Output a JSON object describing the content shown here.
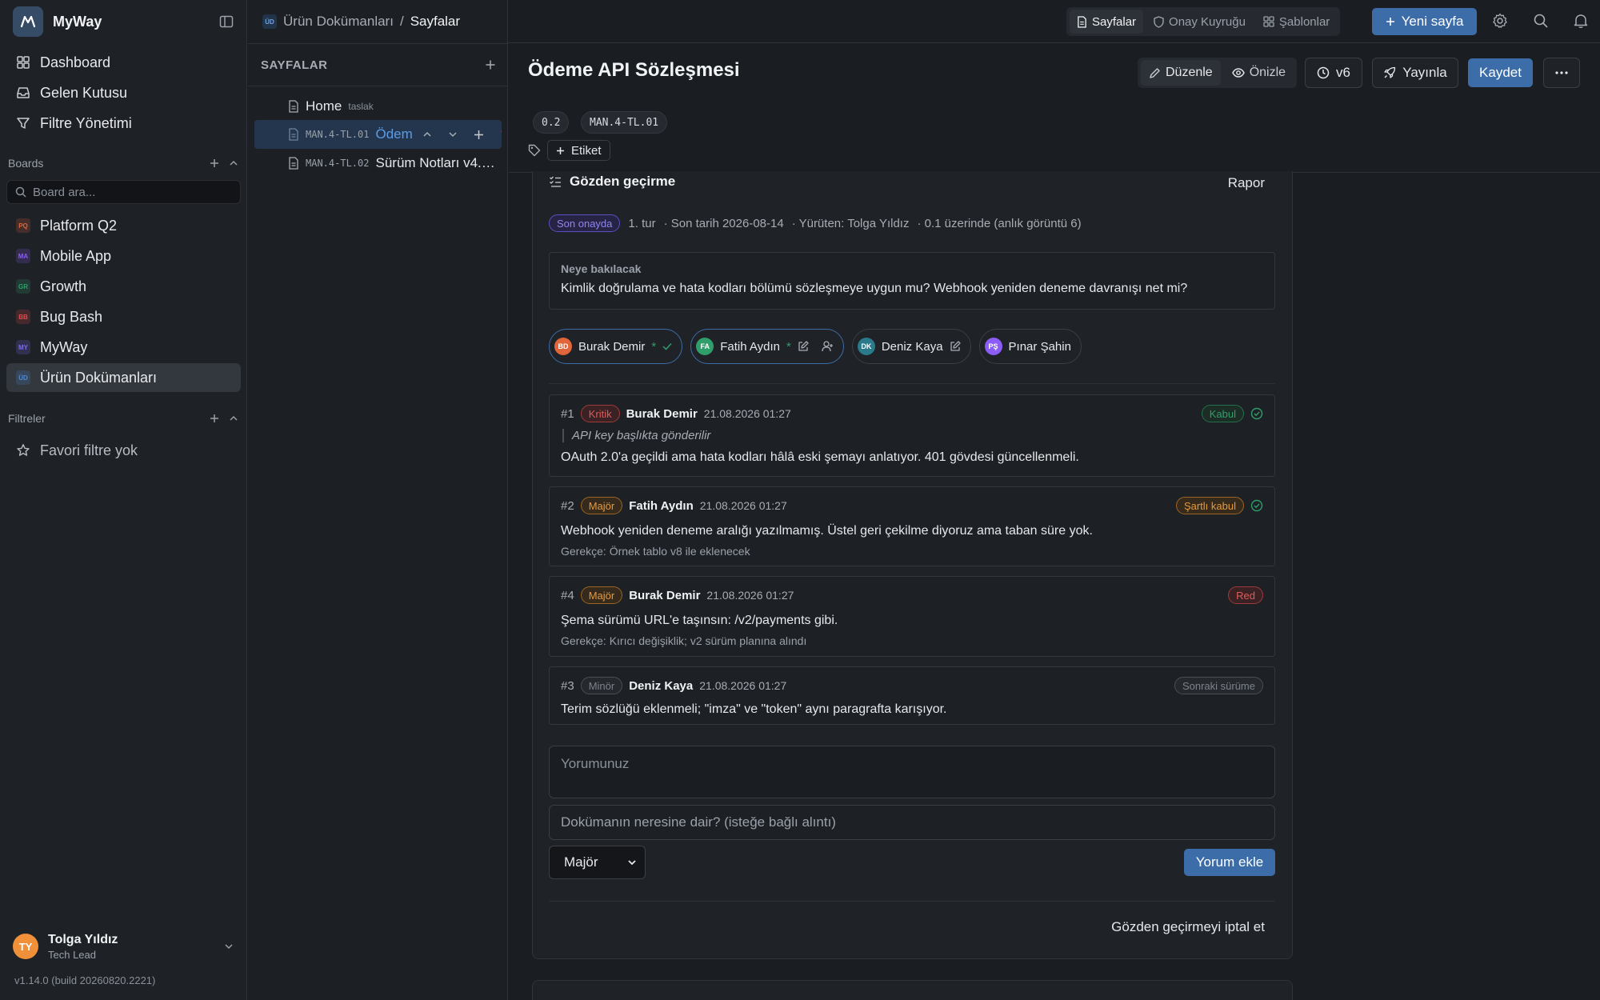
{
  "app": {
    "name": "MyWay",
    "version": "v1.14.0 (build 20260820.2221)"
  },
  "nav": [
    {
      "label": "Dashboard",
      "icon": "dashboard-icon"
    },
    {
      "label": "Gelen Kutusu",
      "icon": "inbox-icon"
    },
    {
      "label": "Filtre Yönetimi",
      "icon": "filter-icon"
    }
  ],
  "boards": {
    "title": "Boards",
    "search_placeholder": "Board ara...",
    "items": [
      {
        "badge": "PQ",
        "label": "Platform Q2",
        "color": "#e0653a"
      },
      {
        "badge": "MA",
        "label": "Mobile App",
        "color": "#8b5cf6"
      },
      {
        "badge": "GR",
        "label": "Growth",
        "color": "#2f9e6a"
      },
      {
        "badge": "BB",
        "label": "Bug Bash",
        "color": "#e04a4a"
      },
      {
        "badge": "MY",
        "label": "MyWay",
        "color": "#7c6cf0"
      },
      {
        "badge": "ÜD",
        "label": "Ürün Dokümanları",
        "color": "#4a8ad8"
      }
    ]
  },
  "filters": {
    "title": "Filtreler",
    "empty": "Favori filtre yok"
  },
  "user": {
    "initials": "TY",
    "name": "Tolga Yıldız",
    "role": "Tech Lead"
  },
  "breadcrumb": {
    "badge": "ÜD",
    "space": "Ürün Dokümanları",
    "separator": "/",
    "current": "Sayfalar"
  },
  "pages_panel": {
    "title": "SAYFALAR",
    "tree": [
      {
        "code": "",
        "label": "Home",
        "tag": "taslak"
      },
      {
        "code": "MAN.4-TL.01",
        "label": "Ödem",
        "tag": ""
      },
      {
        "code": "MAN.4-TL.02",
        "label": "Sürüm Notları v4.…",
        "tag": ""
      }
    ]
  },
  "topbar": {
    "tabs": [
      {
        "label": "Sayfalar",
        "icon": "document-icon"
      },
      {
        "label": "Onay Kuyruğu",
        "icon": "shield-icon"
      },
      {
        "label": "Şablonlar",
        "icon": "grid-icon"
      }
    ],
    "new_page": "Yeni sayfa"
  },
  "doc": {
    "title": "Ödeme API Sözleşmesi",
    "mode_edit": "Düzenle",
    "mode_preview": "Önizle",
    "version": "v6",
    "publish": "Yayınla",
    "save": "Kaydet",
    "chips": [
      "0.2",
      "MAN.4-TL.01"
    ],
    "tag_button": "Etiket"
  },
  "review": {
    "title": "Gözden geçirme",
    "report": "Rapor",
    "status": "Son onayda",
    "meta": [
      "1. tur",
      "· Son tarih 2026-08-14",
      "· Yürüten: Tolga Yıldız",
      "· 0.1 üzerinde (anlık görüntü 6)"
    ],
    "focus_label": "Neye bakılacak",
    "focus_text": "Kimlik doğrulama ve hata kodları bölümü sözleşmeye uygun mu? Webhook yeniden deneme davranışı net mi?",
    "reviewers": [
      {
        "initials": "BD",
        "name": "Burak Demir",
        "color": "#e0653a"
      },
      {
        "initials": "FA",
        "name": "Fatih Aydın",
        "color": "#2f9e6a"
      },
      {
        "initials": "DK",
        "name": "Deniz Kaya",
        "color": "#2a7a8c"
      },
      {
        "initials": "PŞ",
        "name": "Pınar Şahin",
        "color": "#8b5cf6"
      }
    ],
    "comments": [
      {
        "num": "#1",
        "severity": "Kritik",
        "author": "Burak Demir",
        "time": "21.08.2026 01:27",
        "quote": "API key başlıkta gönderilir",
        "text": "OAuth 2.0'a geçildi ama hata kodları hâlâ eski şemayı anlatıyor. 401 gövdesi güncellenmeli.",
        "reason": "",
        "status": "Kabul"
      },
      {
        "num": "#2",
        "severity": "Majör",
        "author": "Fatih Aydın",
        "time": "21.08.2026 01:27",
        "quote": "",
        "text": "Webhook yeniden deneme aralığı yazılmamış. Üstel geri çekilme diyoruz ama taban süre yok.",
        "reason": "Gerekçe: Örnek tablo v8 ile eklenecek",
        "status": "Şartlı kabul"
      },
      {
        "num": "#4",
        "severity": "Majör",
        "author": "Burak Demir",
        "time": "21.08.2026 01:27",
        "quote": "",
        "text": "Şema sürümü URL'e taşınsın: /v2/payments gibi.",
        "reason": "Gerekçe: Kırıcı değişiklik; v2 sürüm planına alındı",
        "status": "Red"
      },
      {
        "num": "#3",
        "severity": "Minör",
        "author": "Deniz Kaya",
        "time": "21.08.2026 01:27",
        "quote": "",
        "text": "Terim sözlüğü eklenmeli; \"imza\" ve \"token\" aynı paragrafta karışıyor.",
        "reason": "",
        "status": "Sonraki sürüme"
      }
    ],
    "comment_placeholder": "Yorumunuz",
    "quote_placeholder": "Dokümanın neresine dair? (isteğe bağlı alıntı)",
    "severity_select": "Majör",
    "add_comment": "Yorum ekle",
    "cancel_review": "Gözden geçirmeyi iptal et"
  }
}
